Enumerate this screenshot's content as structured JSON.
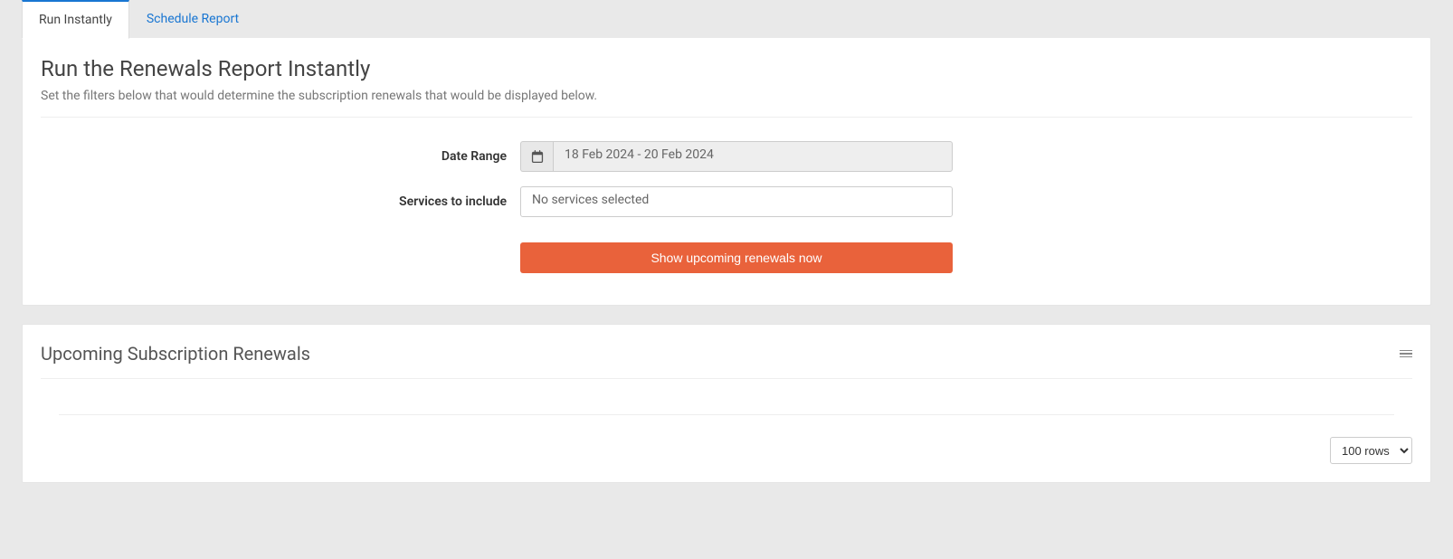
{
  "tabs": {
    "run_instantly": "Run Instantly",
    "schedule_report": "Schedule Report"
  },
  "main": {
    "title": "Run the Renewals Report Instantly",
    "subtitle": "Set the filters below that would determine the subscription renewals that would be displayed below."
  },
  "form": {
    "date_range_label": "Date Range",
    "date_range_value": "18 Feb 2024 - 20 Feb 2024",
    "services_label": "Services to include",
    "services_placeholder": "No services selected",
    "submit_label": "Show upcoming renewals now"
  },
  "results": {
    "title": "Upcoming Subscription Renewals",
    "rows_select": "100 rows"
  }
}
